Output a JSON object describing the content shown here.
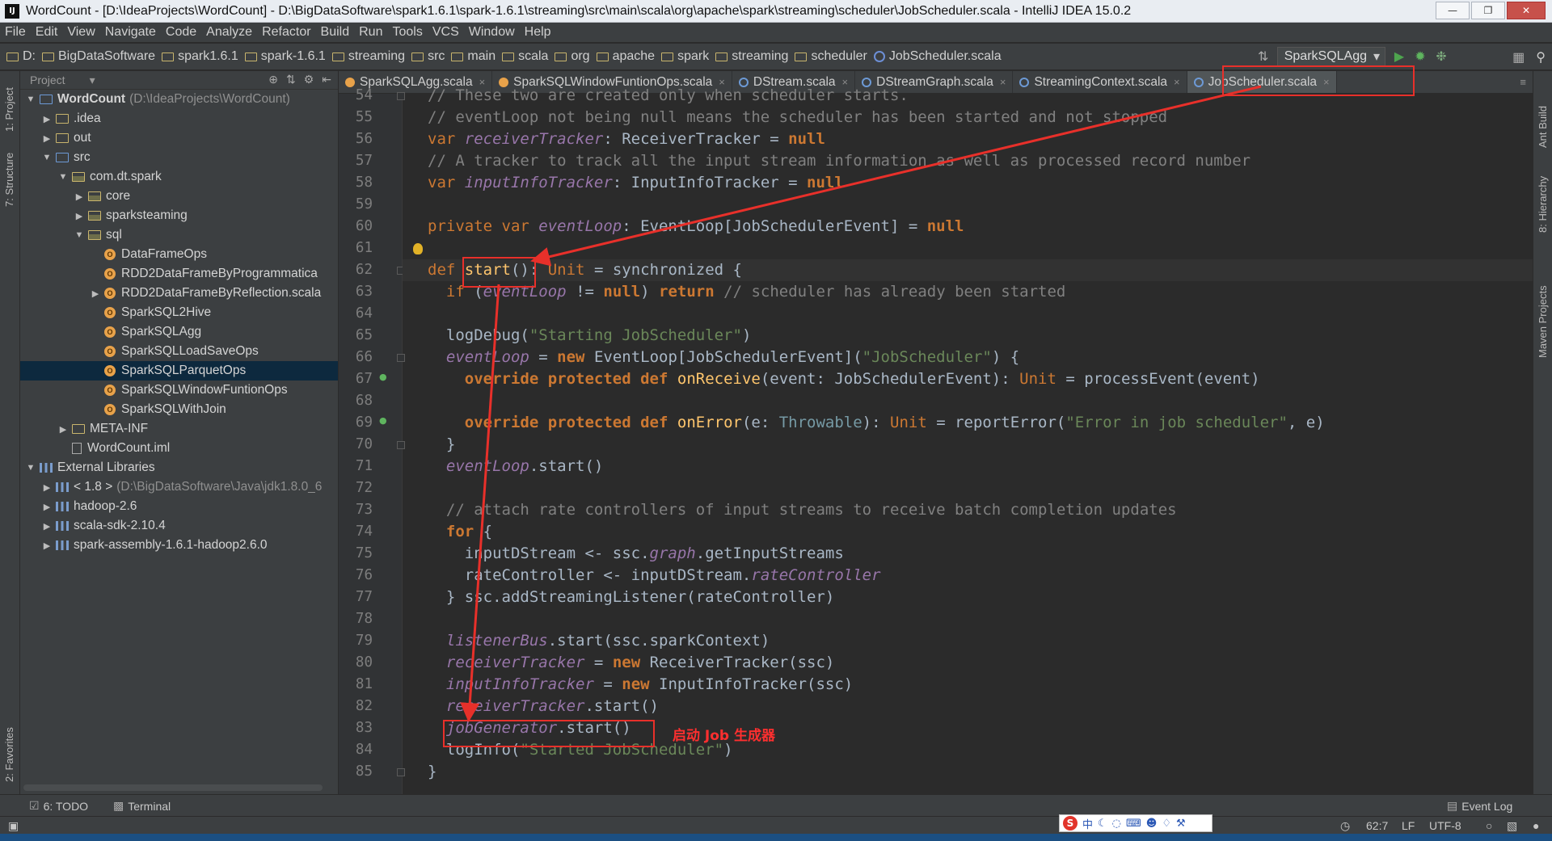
{
  "window": {
    "title": "WordCount - [D:\\IdeaProjects\\WordCount] - D:\\BigDataSoftware\\spark1.6.1\\spark-1.6.1\\streaming\\src\\main\\scala\\org\\apache\\spark\\streaming\\scheduler\\JobScheduler.scala - IntelliJ IDEA 15.0.2",
    "app_icon": "IJ"
  },
  "menu": [
    "File",
    "Edit",
    "View",
    "Navigate",
    "Code",
    "Analyze",
    "Refactor",
    "Build",
    "Run",
    "Tools",
    "VCS",
    "Window",
    "Help"
  ],
  "breadcrumbs": [
    "D:",
    "BigDataSoftware",
    "spark1.6.1",
    "spark-1.6.1",
    "streaming",
    "src",
    "main",
    "scala",
    "org",
    "apache",
    "spark",
    "streaming",
    "scheduler",
    "JobScheduler.scala"
  ],
  "run_config": "SparkSQLAgg",
  "project_panel": {
    "header": "Project",
    "tree": [
      {
        "label": "WordCount",
        "extra": "(D:\\IdeaProjects\\WordCount)",
        "indent": 0,
        "arrow": "▼",
        "icon": "module-folder",
        "bold": true
      },
      {
        "label": ".idea",
        "indent": 1,
        "arrow": "▶",
        "icon": "folder"
      },
      {
        "label": "out",
        "indent": 1,
        "arrow": "▶",
        "icon": "folder"
      },
      {
        "label": "src",
        "indent": 1,
        "arrow": "▼",
        "icon": "source-folder"
      },
      {
        "label": "com.dt.spark",
        "indent": 2,
        "arrow": "▼",
        "icon": "package"
      },
      {
        "label": "core",
        "indent": 3,
        "arrow": "▶",
        "icon": "package"
      },
      {
        "label": "sparksteaming",
        "indent": 3,
        "arrow": "▶",
        "icon": "package"
      },
      {
        "label": "sql",
        "indent": 3,
        "arrow": "▼",
        "icon": "package"
      },
      {
        "label": "DataFrameOps",
        "indent": 4,
        "arrow": "",
        "icon": "scala-object"
      },
      {
        "label": "RDD2DataFrameByProgrammatica",
        "indent": 4,
        "arrow": "",
        "icon": "scala-object"
      },
      {
        "label": "RDD2DataFrameByReflection.scala",
        "indent": 4,
        "arrow": "▶",
        "icon": "scala-object"
      },
      {
        "label": "SparkSQL2Hive",
        "indent": 4,
        "arrow": "",
        "icon": "scala-object"
      },
      {
        "label": "SparkSQLAgg",
        "indent": 4,
        "arrow": "",
        "icon": "scala-object"
      },
      {
        "label": "SparkSQLLoadSaveOps",
        "indent": 4,
        "arrow": "",
        "icon": "scala-object"
      },
      {
        "label": "SparkSQLParquetOps",
        "indent": 4,
        "arrow": "",
        "icon": "scala-object",
        "selected": true
      },
      {
        "label": "SparkSQLWindowFuntionOps",
        "indent": 4,
        "arrow": "",
        "icon": "scala-object"
      },
      {
        "label": "SparkSQLWithJoin",
        "indent": 4,
        "arrow": "",
        "icon": "scala-object"
      },
      {
        "label": "META-INF",
        "indent": 2,
        "arrow": "▶",
        "icon": "folder"
      },
      {
        "label": "WordCount.iml",
        "indent": 2,
        "arrow": "",
        "icon": "file"
      },
      {
        "label": "External Libraries",
        "indent": 0,
        "arrow": "▼",
        "icon": "library"
      },
      {
        "label": "< 1.8 >",
        "extra": "(D:\\BigDataSoftware\\Java\\jdk1.8.0_6",
        "indent": 1,
        "arrow": "▶",
        "icon": "library"
      },
      {
        "label": "hadoop-2.6",
        "indent": 1,
        "arrow": "▶",
        "icon": "library"
      },
      {
        "label": "scala-sdk-2.10.4",
        "indent": 1,
        "arrow": "▶",
        "icon": "library"
      },
      {
        "label": "spark-assembly-1.6.1-hadoop2.6.0",
        "indent": 1,
        "arrow": "▶",
        "icon": "library"
      }
    ]
  },
  "tabs": [
    {
      "label": "SparkSQLAgg.scala",
      "icon": "o"
    },
    {
      "label": "SparkSQLWindowFuntionOps.scala",
      "icon": "o"
    },
    {
      "label": "DStream.scala",
      "icon": "c"
    },
    {
      "label": "DStreamGraph.scala",
      "icon": "c"
    },
    {
      "label": "StreamingContext.scala",
      "icon": "c"
    },
    {
      "label": "JobScheduler.scala",
      "icon": "c",
      "active": true
    }
  ],
  "editor": {
    "first_line": 54,
    "current_line": 62,
    "lines": [
      [
        [
          "cmt",
          "// These two are created only when scheduler starts."
        ]
      ],
      [
        [
          "cmt",
          "// eventLoop not being null means the scheduler has been started and not stopped"
        ]
      ],
      [
        [
          "kw",
          "var "
        ],
        [
          "fld",
          "receiverTracker"
        ],
        [
          "tp",
          ": ReceiverTracker = "
        ],
        [
          "kwb",
          "null"
        ]
      ],
      [
        [
          "cmt",
          "// A tracker to track all the input stream information as well as processed record number"
        ]
      ],
      [
        [
          "kw",
          "var "
        ],
        [
          "fld",
          "inputInfoTracker"
        ],
        [
          "tp",
          ": InputInfoTracker = "
        ],
        [
          "kwb",
          "null"
        ]
      ],
      [],
      [
        [
          "kw",
          "private var "
        ],
        [
          "fld",
          "eventLoop"
        ],
        [
          "tp",
          ": EventLoop[JobSchedulerEvent] = "
        ],
        [
          "kwb",
          "null"
        ]
      ],
      [],
      [
        [
          "kw",
          "def "
        ],
        [
          "fn",
          "start"
        ],
        [
          "tp",
          "(): "
        ],
        [
          "kw",
          "Unit"
        ],
        [
          "tp",
          " = synchronized {"
        ]
      ],
      [
        [
          "tp",
          "  "
        ],
        [
          "kw",
          "if "
        ],
        [
          "tp",
          "("
        ],
        [
          "fld",
          "eventLoop"
        ],
        [
          "tp",
          " != "
        ],
        [
          "kwb",
          "null"
        ],
        [
          "tp",
          ") "
        ],
        [
          "kwb",
          "return "
        ],
        [
          "cmt",
          "// scheduler has already been started"
        ]
      ],
      [],
      [
        [
          "tp",
          "  logDebug("
        ],
        [
          "str",
          "\"Starting JobScheduler\""
        ],
        [
          "tp",
          ")"
        ]
      ],
      [
        [
          "tp",
          "  "
        ],
        [
          "fld",
          "eventLoop"
        ],
        [
          "tp",
          " = "
        ],
        [
          "kwb",
          "new "
        ],
        [
          "tp",
          "EventLoop[JobSchedulerEvent]("
        ],
        [
          "str",
          "\"JobScheduler\""
        ],
        [
          "tp",
          ") {"
        ]
      ],
      [
        [
          "tp",
          "    "
        ],
        [
          "kwb",
          "override protected def "
        ],
        [
          "fn",
          "onReceive"
        ],
        [
          "tp",
          "(event: JobSchedulerEvent): "
        ],
        [
          "kw",
          "Unit"
        ],
        [
          "tp",
          " = processEvent(event)"
        ]
      ],
      [],
      [
        [
          "tp",
          "    "
        ],
        [
          "kwb",
          "override protected def "
        ],
        [
          "fn",
          "onError"
        ],
        [
          "tp",
          "(e: "
        ],
        [
          "thr",
          "Throwable"
        ],
        [
          "tp",
          "): "
        ],
        [
          "kw",
          "Unit"
        ],
        [
          "tp",
          " = reportError("
        ],
        [
          "str",
          "\"Error in job scheduler\""
        ],
        [
          "tp",
          ", e)"
        ]
      ],
      [
        [
          "tp",
          "  }"
        ]
      ],
      [
        [
          "tp",
          "  "
        ],
        [
          "fld",
          "eventLoop"
        ],
        [
          "tp",
          ".start()"
        ]
      ],
      [],
      [
        [
          "tp",
          "  "
        ],
        [
          "cmt",
          "// attach rate controllers of input streams to receive batch completion updates"
        ]
      ],
      [
        [
          "tp",
          "  "
        ],
        [
          "kwb",
          "for "
        ],
        [
          "tp",
          "{"
        ]
      ],
      [
        [
          "tp",
          "    inputDStream <- ssc."
        ],
        [
          "fld",
          "graph"
        ],
        [
          "tp",
          ".getInputStreams"
        ]
      ],
      [
        [
          "tp",
          "    rateController <- inputDStream."
        ],
        [
          "fld",
          "rateController"
        ]
      ],
      [
        [
          "tp",
          "  } ssc.addStreamingListener(rateController)"
        ]
      ],
      [],
      [
        [
          "tp",
          "  "
        ],
        [
          "fld",
          "listenerBus"
        ],
        [
          "tp",
          ".start(ssc.sparkContext)"
        ]
      ],
      [
        [
          "tp",
          "  "
        ],
        [
          "fld",
          "receiverTracker"
        ],
        [
          "tp",
          " = "
        ],
        [
          "kwb",
          "new "
        ],
        [
          "tp",
          "ReceiverTracker(ssc)"
        ]
      ],
      [
        [
          "tp",
          "  "
        ],
        [
          "fld",
          "inputInfoTracker"
        ],
        [
          "tp",
          " = "
        ],
        [
          "kwb",
          "new "
        ],
        [
          "tp",
          "InputInfoTracker(ssc)"
        ]
      ],
      [
        [
          "tp",
          "  "
        ],
        [
          "fld",
          "receiverTracker"
        ],
        [
          "tp",
          ".start()"
        ]
      ],
      [
        [
          "tp",
          "  "
        ],
        [
          "fld",
          "jobGenerator"
        ],
        [
          "tp",
          ".start()"
        ]
      ],
      [
        [
          "tp",
          "  logInfo("
        ],
        [
          "str",
          "\"Started JobScheduler\""
        ],
        [
          "tp",
          ")"
        ]
      ],
      [
        [
          "tp",
          "}"
        ]
      ]
    ]
  },
  "annotation": {
    "note": "启动 Job 生成器",
    "color": "#e8302a"
  },
  "left_strip": [
    "1: Project",
    "7: Structure",
    "2: Favorites"
  ],
  "right_strip": [
    "Ant Build",
    "8: Hierarchy",
    "Maven Projects"
  ],
  "bottom_bar": {
    "todo": "6: TODO",
    "terminal": "Terminal",
    "event_log": "Event Log"
  },
  "status": {
    "position": "62:7",
    "line_sep": "LF",
    "encoding": "UTF-8"
  },
  "colors": {
    "keyword": "#cc7832",
    "string": "#6a8759",
    "comment": "#808080",
    "field": "#9876aa",
    "function": "#ffc66d",
    "annotation": "#e8302a"
  }
}
